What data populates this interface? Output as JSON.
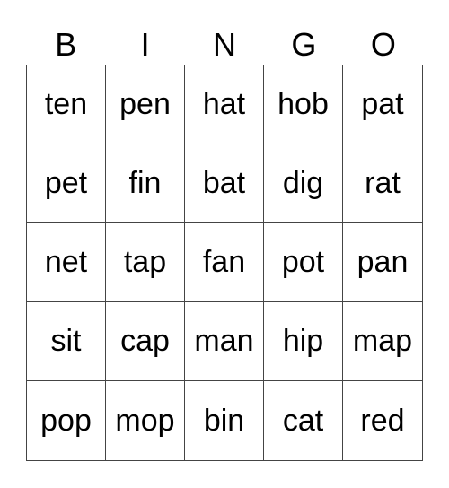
{
  "header": [
    "B",
    "I",
    "N",
    "G",
    "O"
  ],
  "rows": [
    [
      "ten",
      "pen",
      "hat",
      "hob",
      "pat"
    ],
    [
      "pet",
      "fin",
      "bat",
      "dig",
      "rat"
    ],
    [
      "net",
      "tap",
      "fan",
      "pot",
      "pan"
    ],
    [
      "sit",
      "cap",
      "man",
      "hip",
      "map"
    ],
    [
      "pop",
      "mop",
      "bin",
      "cat",
      "red"
    ]
  ]
}
